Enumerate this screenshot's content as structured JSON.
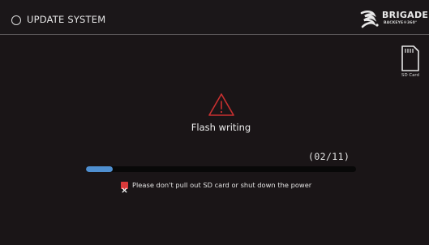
{
  "header": {
    "title": "UPDATE SYSTEM",
    "circle_icon": "circle-outline-icon",
    "logo": {
      "brand": "BRIGADE",
      "sub": "BACKEYE®360°"
    }
  },
  "sd_card": {
    "icon": "sd-card-icon",
    "label": "SD Card"
  },
  "status": {
    "icon": "warning-triangle-icon",
    "text": "Flash writing"
  },
  "progress": {
    "counter": "(02/11)",
    "current": 2,
    "total": 11,
    "fill_fraction": 0.1
  },
  "notice": {
    "icon": "red-x-icon",
    "text": "Please don't pull out SD card or shut down the power"
  },
  "colors": {
    "background": "#1a1517",
    "progress_fill": "#4f8fd0",
    "warning": "#c83030",
    "notice_icon": "#d93a3a"
  }
}
